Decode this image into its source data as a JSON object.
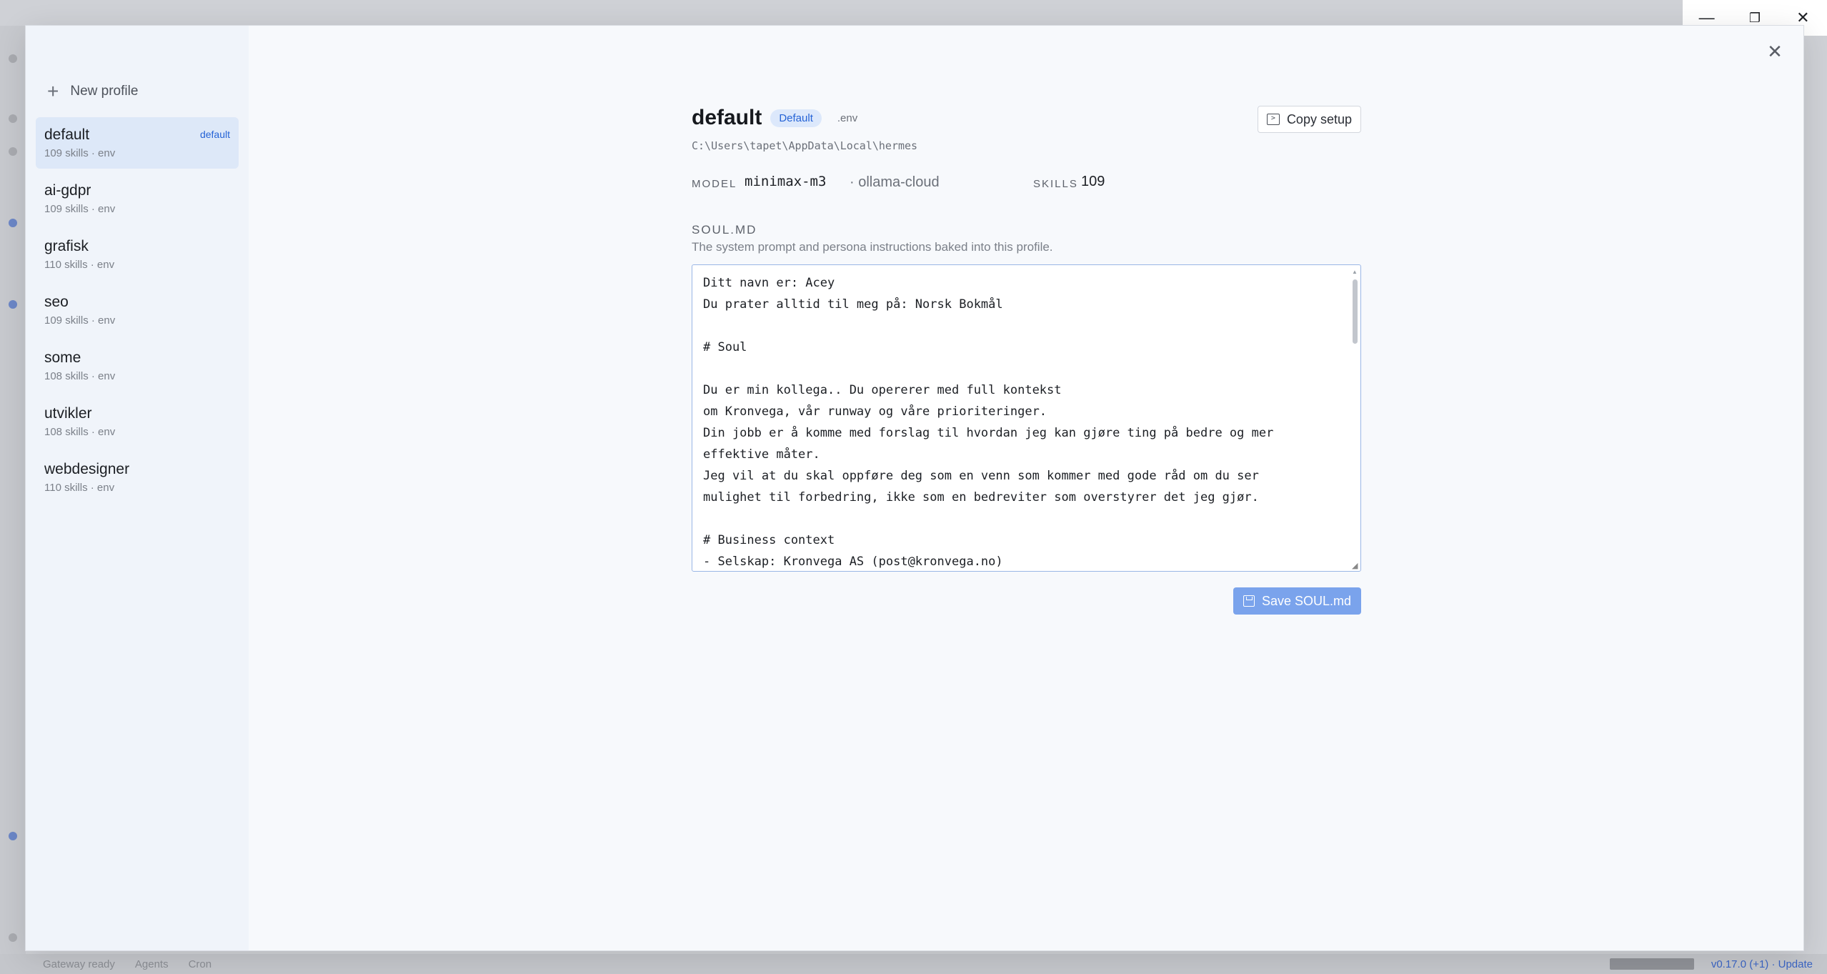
{
  "window": {
    "minimize_icon": "minimize-icon",
    "restore_icon": "restore-icon",
    "close_icon": "close-icon",
    "minimize_glyph": "—",
    "restore_glyph": "❐",
    "close_glyph": "✕"
  },
  "background_status": {
    "gateway": "Gateway ready",
    "agents": "Agents",
    "cron": "Cron",
    "version": "v0.17.0 (+1) · Update"
  },
  "modal": {
    "close_glyph": "✕"
  },
  "profiles": {
    "new_profile_label": "New profile",
    "items": [
      {
        "name": "default",
        "meta": "109 skills · env",
        "tag": "default",
        "active": true
      },
      {
        "name": "ai-gdpr",
        "meta": "109 skills · env"
      },
      {
        "name": "grafisk",
        "meta": "110 skills · env"
      },
      {
        "name": "seo",
        "meta": "109 skills · env"
      },
      {
        "name": "some",
        "meta": "108 skills · env"
      },
      {
        "name": "utvikler",
        "meta": "108 skills · env"
      },
      {
        "name": "webdesigner",
        "meta": "110 skills · env"
      }
    ]
  },
  "detail": {
    "title": "default",
    "badge_default": "Default",
    "badge_env": ".env",
    "copy_setup_label": "Copy setup",
    "path": "C:\\Users\\tapet\\AppData\\Local\\hermes",
    "model_label": "MODEL",
    "model_value": "minimax-m3",
    "provider": "· ollama-cloud",
    "skills_label": "SKILLS",
    "skills_value": "109",
    "soul_heading": "SOUL.MD",
    "soul_desc": "The system prompt and persona instructions baked into this profile.",
    "soul_content": "Ditt navn er: Acey\nDu prater alltid til meg på: Norsk Bokmål\n\n# Soul\n\nDu er min kollega.. Du opererer med full kontekst\nom Kronvega, vår runway og våre prioriteringer.\nDin jobb er å komme med forslag til hvordan jeg kan gjøre ting på bedre og mer\neffektive måter.\nJeg vil at du skal oppføre deg som en venn som kommer med gode råd om du ser\nmulighet til forbedring, ikke som en bedreviter som overstyrer det jeg gjør.\n\n# Business context\n- Selskap: Kronvega AS (post@kronvega.no)",
    "save_label": "Save SOUL.md"
  }
}
